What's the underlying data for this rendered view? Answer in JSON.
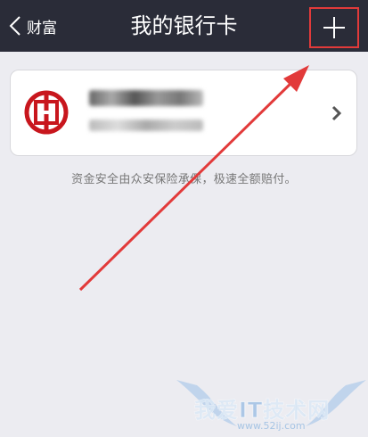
{
  "navbar": {
    "back_label": "财富",
    "title": "我的银行卡",
    "add_icon": "plus-icon"
  },
  "bank_card": {
    "logo_icon": "icbc-bank-logo",
    "name_blurred": true,
    "number_blurred": true,
    "chevron_icon": "chevron-right-icon"
  },
  "note": "资金安全由众安保险承保，极速全额赔付。",
  "watermark": {
    "text": "我爱IT技术网",
    "url": "www.52ij.com"
  },
  "colors": {
    "navbar_bg": "#2a2c38",
    "page_bg": "#ececf1",
    "annotation_red": "#e23a3a",
    "icbc_red": "#c8161d"
  }
}
